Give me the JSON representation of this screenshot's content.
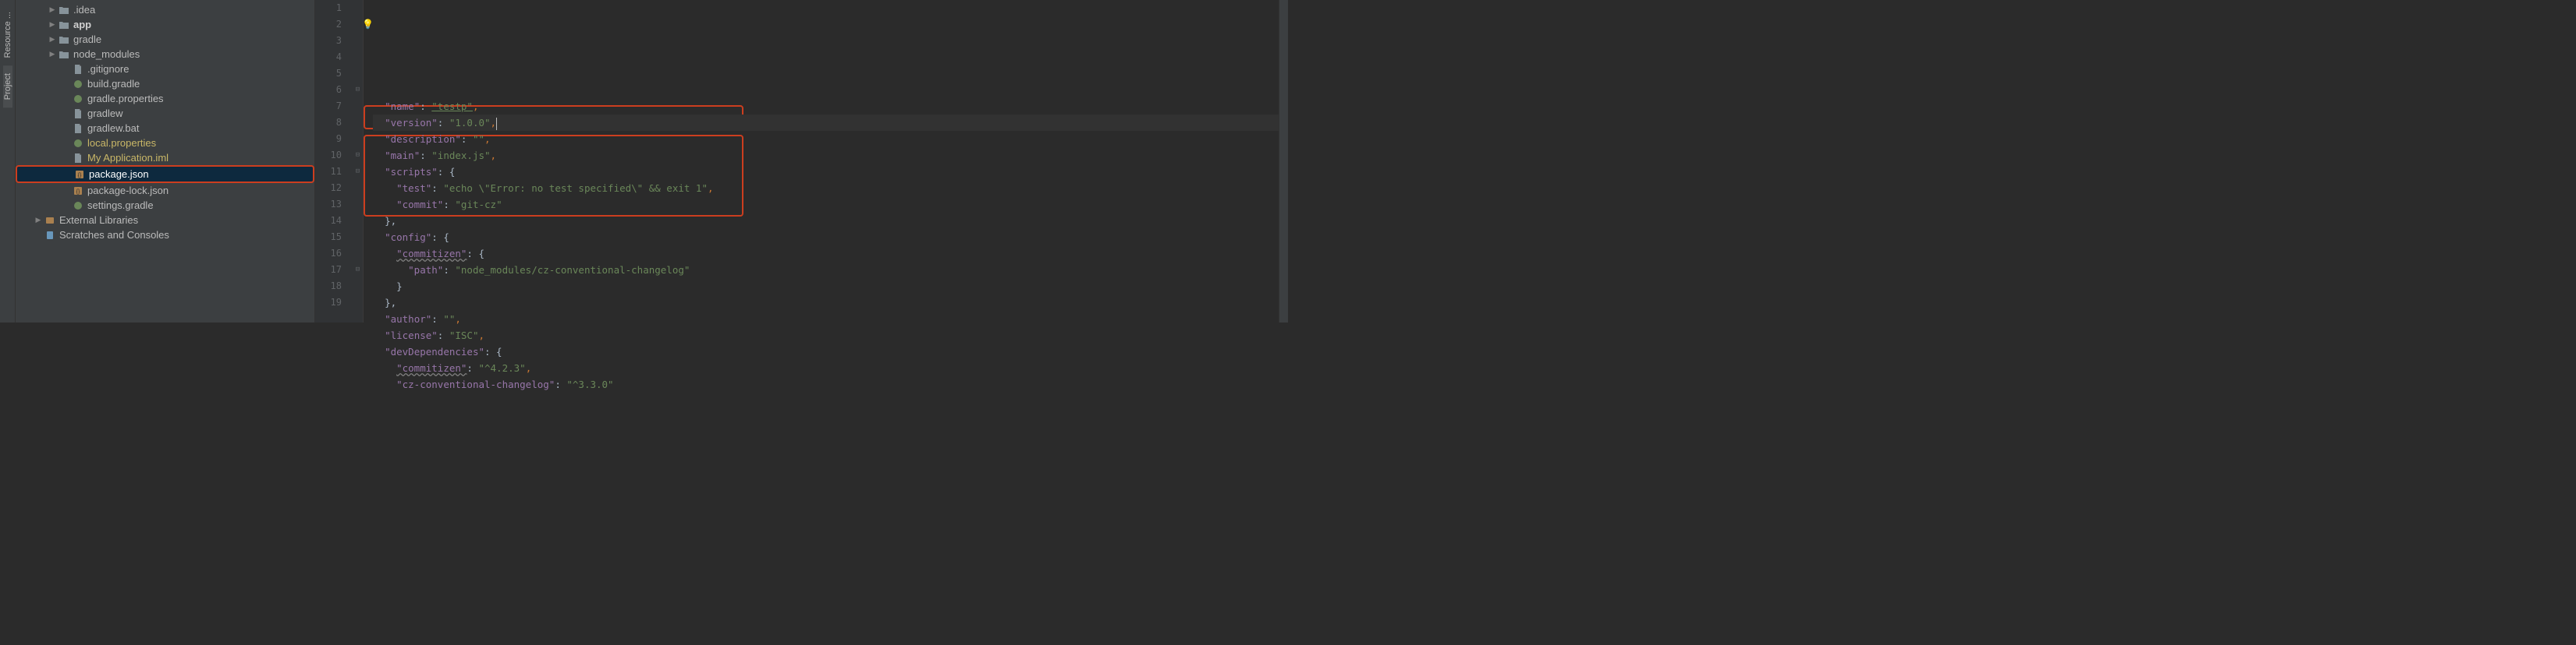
{
  "toolwindows": [
    {
      "label": "Resource ...",
      "icon": "cube-icon"
    },
    {
      "label": "Project",
      "icon": "project-icon",
      "active": true
    }
  ],
  "tree": [
    {
      "indent": 1,
      "arrow": "▶",
      "icon": "folder",
      "label": ".idea"
    },
    {
      "indent": 1,
      "arrow": "▶",
      "icon": "folder",
      "label": "app",
      "bold": true
    },
    {
      "indent": 1,
      "arrow": "▶",
      "icon": "folder",
      "label": "gradle"
    },
    {
      "indent": 1,
      "arrow": "▶",
      "icon": "folder",
      "label": "node_modules"
    },
    {
      "indent": 2,
      "arrow": "",
      "icon": "file",
      "label": ".gitignore"
    },
    {
      "indent": 2,
      "arrow": "",
      "icon": "gradle",
      "label": "build.gradle"
    },
    {
      "indent": 2,
      "arrow": "",
      "icon": "gradle",
      "label": "gradle.properties"
    },
    {
      "indent": 2,
      "arrow": "",
      "icon": "file",
      "label": "gradlew"
    },
    {
      "indent": 2,
      "arrow": "",
      "icon": "file",
      "label": "gradlew.bat"
    },
    {
      "indent": 2,
      "arrow": "",
      "icon": "gradle",
      "label": "local.properties",
      "highlight": true
    },
    {
      "indent": 2,
      "arrow": "",
      "icon": "file",
      "label": "My Application.iml",
      "highlight": true
    },
    {
      "indent": 2,
      "arrow": "",
      "icon": "json",
      "label": "package.json",
      "selected": true
    },
    {
      "indent": 2,
      "arrow": "",
      "icon": "json",
      "label": "package-lock.json"
    },
    {
      "indent": 2,
      "arrow": "",
      "icon": "gradle",
      "label": "settings.gradle"
    },
    {
      "indent": 0,
      "arrow": "▶",
      "icon": "lib",
      "label": "External Libraries"
    },
    {
      "indent": 0,
      "arrow": "",
      "icon": "scratch",
      "label": "Scratches and Consoles"
    }
  ],
  "lineNumbers": [
    "1",
    "2",
    "3",
    "4",
    "5",
    "6",
    "7",
    "8",
    "9",
    "10",
    "11",
    "12",
    "13",
    "14",
    "15",
    "16",
    "17",
    "18",
    "19"
  ],
  "foldMarks": [
    "",
    "",
    "",
    "",
    "",
    "⊟",
    "",
    "",
    "",
    "⊟",
    "⊟",
    "",
    "",
    "",
    "",
    "",
    "⊟",
    "",
    ""
  ],
  "code": {
    "l1": "",
    "l2": {
      "k": "\"name\"",
      "c": ": ",
      "v": "\"testp\"",
      "e": ","
    },
    "l3": {
      "k": "\"version\"",
      "c": ": ",
      "v": "\"1.0.0\"",
      "e": ","
    },
    "l4": {
      "k": "\"description\"",
      "c": ": ",
      "v": "\"\"",
      "e": ","
    },
    "l5": {
      "k": "\"main\"",
      "c": ": ",
      "v": "\"index.js\"",
      "e": ","
    },
    "l6": {
      "k": "\"scripts\"",
      "c": ": {"
    },
    "l7": {
      "k": "\"test\"",
      "c": ": ",
      "v": "\"echo \\\"Error: no test specified\\\" && exit 1\"",
      "e": ","
    },
    "l8": {
      "k": "\"commit\"",
      "c": ": ",
      "v": "\"git-cz\""
    },
    "l9": {
      "t": "},"
    },
    "l10": {
      "k": "\"config\"",
      "c": ": {"
    },
    "l11": {
      "k": "\"commitizen\"",
      "c": ": {"
    },
    "l12": {
      "k": "\"path\"",
      "c": ": ",
      "v": "\"node_modules/cz-conventional-changelog\""
    },
    "l13": {
      "t": "}"
    },
    "l14": {
      "t": "},"
    },
    "l15": {
      "k": "\"author\"",
      "c": ": ",
      "v": "\"\"",
      "e": ","
    },
    "l16": {
      "k": "\"license\"",
      "c": ": ",
      "v": "\"ISC\"",
      "e": ","
    },
    "l17": {
      "k": "\"devDependencies\"",
      "c": ": {"
    },
    "l18": {
      "k": "\"commitizen\"",
      "c": ": ",
      "v": "\"^4.2.3\"",
      "e": ","
    },
    "l19": {
      "k": "\"cz-conventional-changelog\"",
      "c": ": ",
      "v": "\"^3.3.0\""
    }
  },
  "indents": {
    "l2": 1,
    "l3": 1,
    "l4": 1,
    "l5": 1,
    "l6": 1,
    "l7": 2,
    "l8": 2,
    "l9": 1,
    "l10": 1,
    "l11": 2,
    "l12": 3,
    "l13": 2,
    "l14": 1,
    "l15": 1,
    "l16": 1,
    "l17": 1,
    "l18": 2,
    "l19": 2
  },
  "underlineKeys": [
    "l11",
    "l18"
  ],
  "underlineVals": [
    "l2"
  ]
}
